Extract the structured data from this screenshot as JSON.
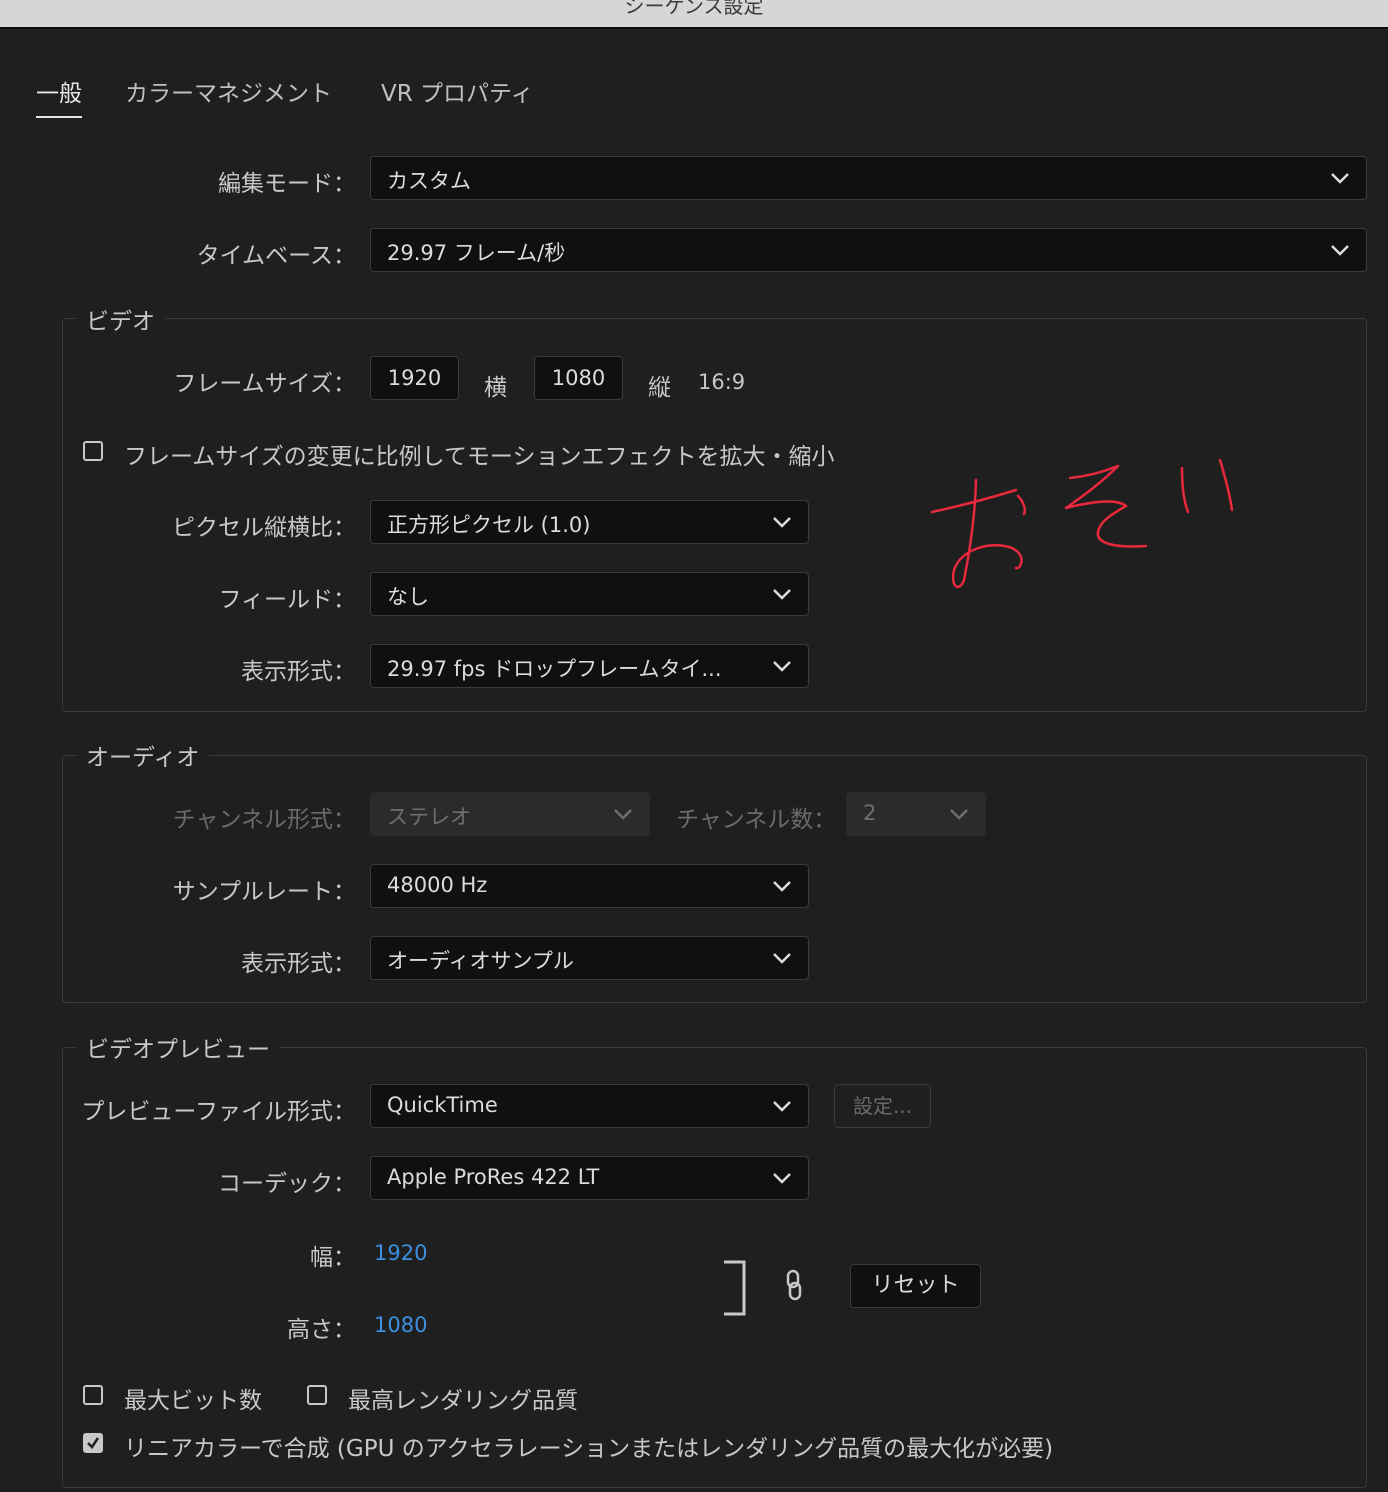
{
  "window": {
    "title": "シーケンス設定"
  },
  "tabs": [
    {
      "label": "一般",
      "active": true
    },
    {
      "label": "カラーマネジメント"
    },
    {
      "label": "VR プロパティ"
    }
  ],
  "general": {
    "edit_mode": {
      "label": "編集モード：",
      "value": "カスタム"
    },
    "timebase": {
      "label": "タイムベース：",
      "value": "29.97  フレーム/秒"
    }
  },
  "video": {
    "title": "ビデオ",
    "frame_size": {
      "label": "フレームサイズ：",
      "width": "1920",
      "width_unit": "横",
      "height": "1080",
      "height_unit": "縦",
      "aspect": "16:9"
    },
    "scale_checkbox": {
      "label": "フレームサイズの変更に比例してモーションエフェクトを拡大・縮小",
      "checked": false
    },
    "pixel_aspect": {
      "label": "ピクセル縦横比：",
      "value": "正方形ピクセル (1.0)"
    },
    "fields": {
      "label": "フィールド：",
      "value": "なし"
    },
    "display_format": {
      "label": "表示形式：",
      "value": "29.97 fps ドロップフレームタイ..."
    }
  },
  "audio": {
    "title": "オーディオ",
    "channel_format": {
      "label": "チャンネル形式：",
      "value": "ステレオ",
      "disabled": true
    },
    "channel_count": {
      "label": "チャンネル数：",
      "value": "2",
      "disabled": true
    },
    "sample_rate": {
      "label": "サンプルレート：",
      "value": "48000 Hz"
    },
    "display_format": {
      "label": "表示形式：",
      "value": "オーディオサンプル"
    }
  },
  "preview": {
    "title": "ビデオプレビュー",
    "file_format": {
      "label": "プレビューファイル形式：",
      "value": "QuickTime"
    },
    "settings_button": "設定...",
    "codec": {
      "label": "コーデック：",
      "value": "Apple ProRes 422 LT"
    },
    "width": {
      "label": "幅：",
      "value": "1920"
    },
    "height": {
      "label": "高さ：",
      "value": "1080"
    },
    "reset_button": "リセット",
    "max_bit_depth": {
      "label": "最大ビット数",
      "checked": false
    },
    "max_render_quality": {
      "label": "最高レンダリング品質",
      "checked": false
    },
    "linear_color": {
      "label": "リニアカラーで合成 (GPU のアクセラレーションまたはレンダリング品質の最大化が必要)",
      "checked": true
    }
  },
  "annotation": {
    "handwritten_text": "おそい",
    "color": "#e8283c"
  },
  "colors": {
    "accent_value": "#3d8fe0",
    "background": "#1f1f1f"
  }
}
